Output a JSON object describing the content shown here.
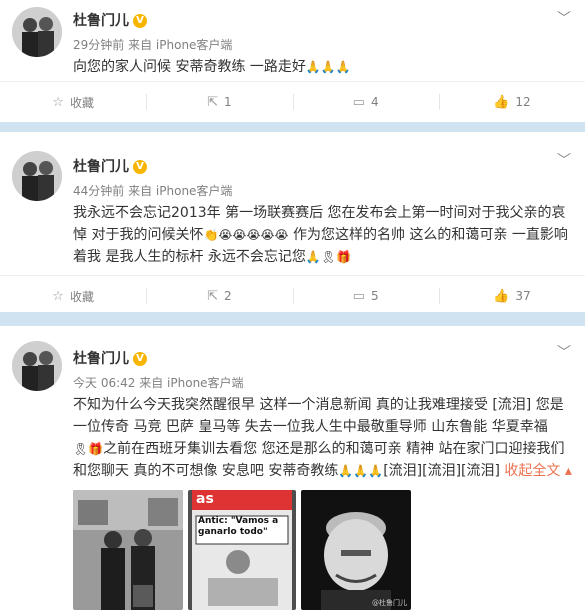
{
  "posts": [
    {
      "author": "杜鲁门儿",
      "time": "29分钟前",
      "source": "来自 iPhone客户端",
      "text": "向您的家人问候 安蒂奇教练 一路走好",
      "emojis": [
        "🙏",
        "🙏",
        "🙏"
      ],
      "actions": {
        "favorite_label": "收藏",
        "repost_count": "1",
        "comment_count": "4",
        "like_count": "12"
      }
    },
    {
      "author": "杜鲁门儿",
      "time": "44分钟前",
      "source": "来自 iPhone客户端",
      "text_a": "我永远不会忘记2013年 第一场联赛赛后 您在发布会上第一时间对于我父亲的哀悼 对于我的问候关怀",
      "text_b": "作为您这样的名帅 这么的和蔼可亲 一直影响着我 是我人生的标杆 永远不会忘记您",
      "actions": {
        "favorite_label": "收藏",
        "repost_count": "2",
        "comment_count": "5",
        "like_count": "37"
      }
    },
    {
      "author": "杜鲁门儿",
      "time": "今天 06:42",
      "source": "来自 iPhone客户端",
      "text_a": "不知为什么今天我突然醒很早 这样一个消息新闻 真的让我难理接受 [流泪] 您是一位传奇 马竞 巴萨 皇马等 失去一位我人生中最敬重导师 山东鲁能 华夏幸福",
      "text_b": "之前在西班牙集训去看您 您还是那么的和蔼可亲 精神 站在家门口迎接我们 和您聊天 真的不可想像 安息吧 安蒂奇教练",
      "text_c": "[流泪][流泪][流泪]",
      "expand_label": "收起全文",
      "image2_headline": "Antic: \"Vamos a ganarlo todo\"",
      "image2_masthead": "as",
      "watermark": "@杜鲁门儿"
    }
  ],
  "colors": {
    "accent": "#eb7350",
    "verified": "#f7b500",
    "separator": "#cfe3f0"
  }
}
